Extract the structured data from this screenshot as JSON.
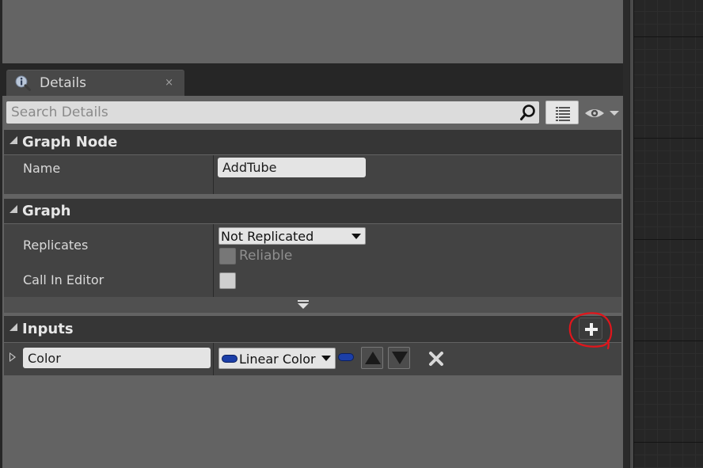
{
  "details_tab": {
    "title": "Details",
    "close_glyph": "×",
    "icon": "info-search-icon"
  },
  "search": {
    "placeholder": "Search Details",
    "value": ""
  },
  "toolbar": {
    "view_options_icon": "list-view-icon",
    "visibility_icon": "eye-icon"
  },
  "graph_node": {
    "title": "Graph Node",
    "name_label": "Name",
    "name_value": "AddTube"
  },
  "graph": {
    "title": "Graph",
    "replicates_label": "Replicates",
    "replicates_value": "Not Replicated",
    "reliable_label": "Reliable",
    "reliable_checked": false,
    "call_in_editor_label": "Call In Editor",
    "call_in_editor_checked": false
  },
  "inputs": {
    "title": "Inputs",
    "add_icon": "plus-icon",
    "items": [
      {
        "name": "Color",
        "type": "Linear Color",
        "pin_color": "#1c3fa8"
      }
    ]
  },
  "colors": {
    "panel_bg": "#636363",
    "header_bg": "#363636",
    "row_bg": "#434343",
    "highlight": "#e0161c",
    "pin": "#1c3fa8"
  }
}
